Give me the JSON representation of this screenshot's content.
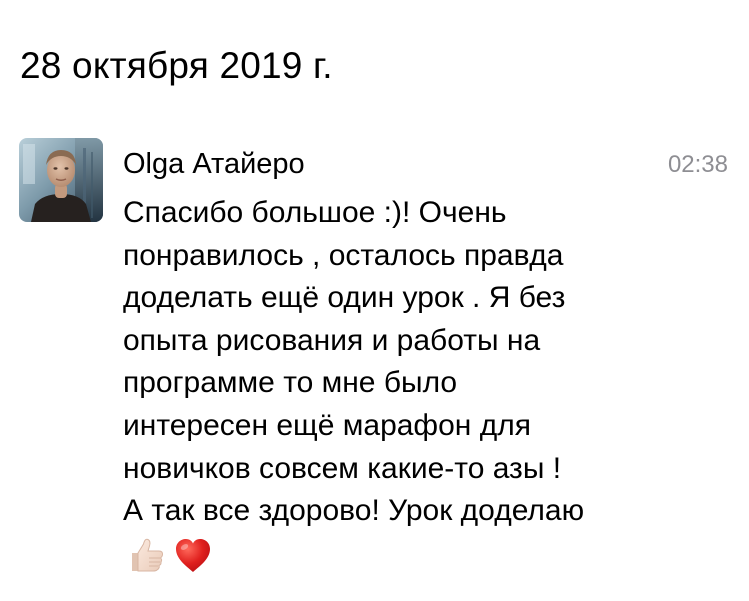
{
  "conversation": {
    "date_header": "28 октября 2019 г."
  },
  "message": {
    "author": "Olga Атайеро",
    "time": "02:38",
    "text": "Спасибо большое :)! Очень\nпонравилось , осталось правда\nдоделать ещё один урок . Я без\nопыта рисования и работы на\nпрограмме то мне было\nинтересен ещё марафон для\nновичков совсем какие-то азы !\nА так все здорово! Урок доделаю",
    "emojis": [
      "thumbs-up-light-skin",
      "red-heart"
    ]
  },
  "colors": {
    "background": "#ffffff",
    "text": "#000000",
    "timestamp": "#8e8e93",
    "heart": "#e0201e"
  }
}
